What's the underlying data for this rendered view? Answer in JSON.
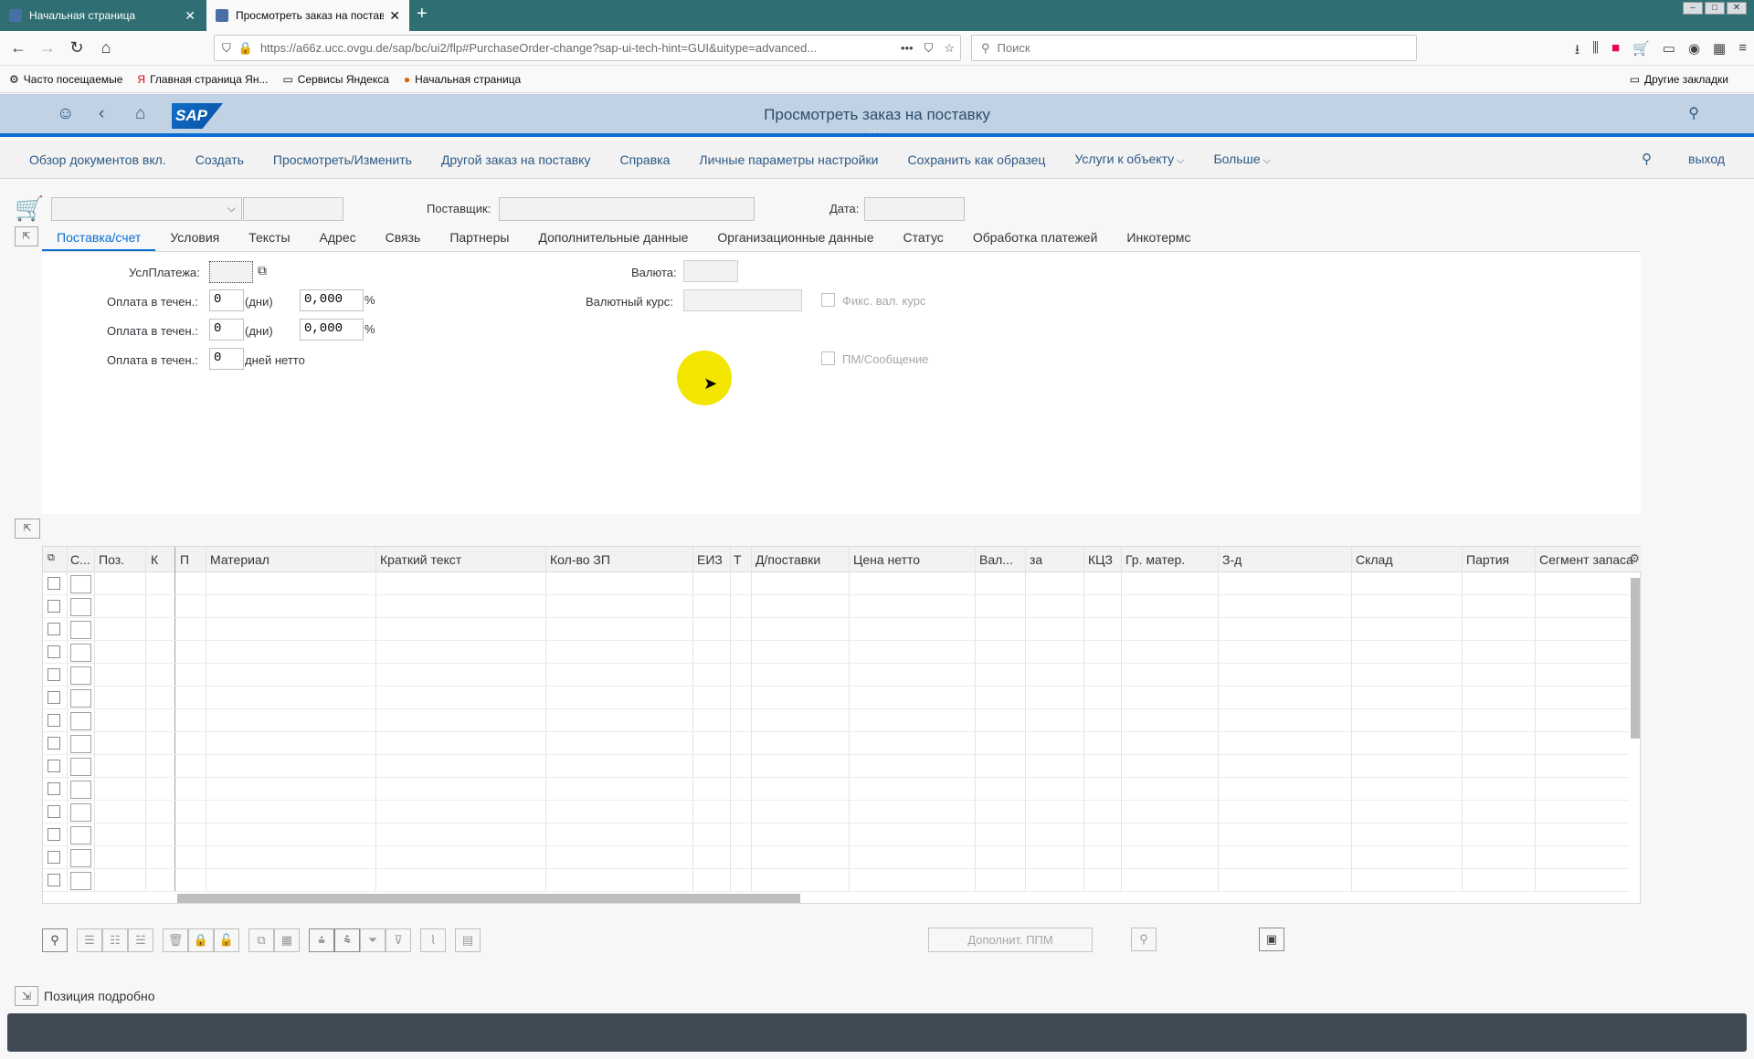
{
  "browser": {
    "tabs": [
      {
        "title": "Начальная страница"
      },
      {
        "title": "Просмотреть заказ на постав..."
      }
    ],
    "url": "https://a66z.ucc.ovgu.de/sap/bc/ui2/flp#PurchaseOrder-change?sap-ui-tech-hint=GUI&uitype=advanced...",
    "search_placeholder": "Поиск",
    "bookmarks": [
      "Часто посещаемые",
      "Главная страница Ян...",
      "Сервисы Яндекса",
      "Начальная страница"
    ],
    "other_bookmarks": "Другие закладки"
  },
  "shell": {
    "title": "Просмотреть заказ на поставку",
    "logo": "SAP"
  },
  "toolbar": {
    "items": [
      "Обзор документов вкл.",
      "Создать",
      "Просмотреть/Изменить",
      "Другой заказ на поставку",
      "Справка",
      "Личные параметры настройки",
      "Сохранить как образец",
      "Услуги к объекту",
      "Больше"
    ],
    "exit": "выход"
  },
  "header": {
    "supplier_label": "Поставщик:",
    "date_label": "Дата:"
  },
  "tabs": [
    "Поставка/счет",
    "Условия",
    "Тексты",
    "Адрес",
    "Связь",
    "Партнеры",
    "Дополнительные данные",
    "Организационные данные",
    "Статус",
    "Обработка платежей",
    "Инкотермс"
  ],
  "form": {
    "payment_terms_label": "УслПлатежа:",
    "pay_within_label": "Оплата в течен.:",
    "days1": "0",
    "days_unit": "(дни)",
    "pct1": "0,000",
    "pct_unit": "%",
    "days2": "0",
    "pct2": "0,000",
    "days3": "0",
    "net_unit": "дней  нетто",
    "currency_label": "Валюта:",
    "exchange_rate_label": "Валютный курс:",
    "fixed_rate_label": "Фикс. вал. курс",
    "gr_message_label": "ПМ/Сообщение"
  },
  "table": {
    "columns": [
      "С...",
      "Поз.",
      "К",
      "П",
      "Материал",
      "Краткий текст",
      "Кол-во ЗП",
      "ЕИЗ",
      "Т",
      "Д/поставки",
      "Цена нетто",
      "Вал...",
      "за",
      "КЦЗ",
      "Гр. матер.",
      "З-д",
      "Склад",
      "Партия",
      "Сегмент запаса"
    ],
    "row_count": 14
  },
  "bottom": {
    "more_button": "Дополнит. ППМ",
    "item_detail": "Позиция подробно"
  }
}
